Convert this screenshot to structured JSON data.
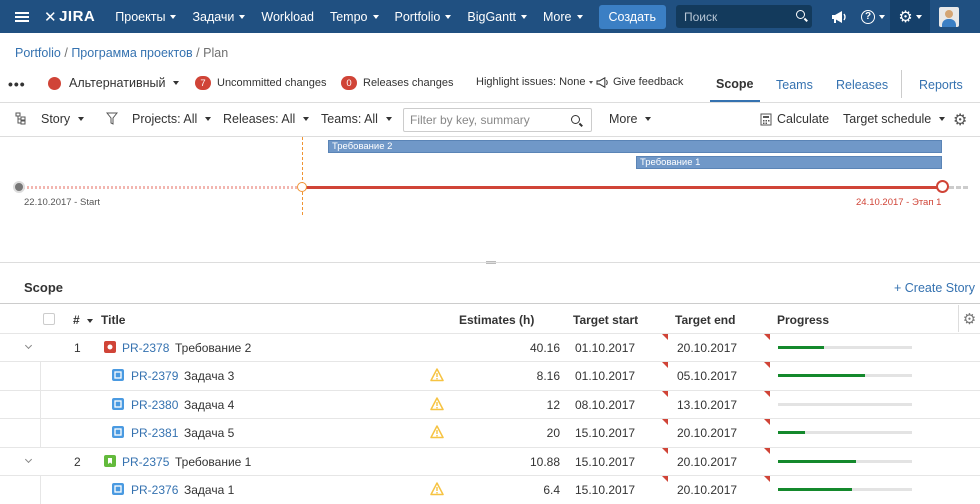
{
  "topnav": {
    "logo": "JIRA",
    "items": [
      "Проекты",
      "Задачи",
      "Workload",
      "Tempo",
      "Portfolio",
      "BigGantt",
      "More"
    ],
    "create_label": "Создать",
    "search_placeholder": "Поиск",
    "help_glyph": "?"
  },
  "breadcrumb": {
    "part1": "Portfolio",
    "part2": "Программа проектов",
    "part3": "Plan",
    "sep": "/"
  },
  "toolbar2": {
    "dots": "•••",
    "scenario": "Альтернативный",
    "uncommitted_count": "7",
    "uncommitted_label": "Uncommitted changes",
    "releases_count": "0",
    "releases_label": "Releases changes",
    "highlight": "Highlight issues: None",
    "feedback": "Give feedback",
    "tabs": [
      "Scope",
      "Teams",
      "Releases",
      "Reports"
    ]
  },
  "filters": {
    "story": "Story",
    "projects": "Projects: All",
    "releases": "Releases: All",
    "teams": "Teams: All",
    "filter_placeholder": "Filter by key, summary",
    "more": "More",
    "calculate": "Calculate",
    "target_schedule": "Target schedule"
  },
  "timeline": {
    "bars": [
      "Требование 2",
      "Требование 1"
    ],
    "start_label": "22.10.2017 - Start",
    "end_label": "24.10.2017 - Этап 1"
  },
  "scope": {
    "title": "Scope",
    "create_story": "+ Create Story",
    "columns": [
      "#",
      "Title",
      "Estimates (h)",
      "Target start",
      "Target end",
      "Progress"
    ],
    "rows": [
      {
        "num": "1",
        "key": "PR-2378",
        "title": "Требование 2",
        "est": "40.16",
        "start": "01.10.2017",
        "end": "20.10.2017",
        "progress": 0.34,
        "level": 0,
        "type": "epic",
        "warn": false
      },
      {
        "num": "",
        "key": "PR-2379",
        "title": "Задача 3",
        "est": "8.16",
        "start": "01.10.2017",
        "end": "05.10.2017",
        "progress": 0.65,
        "level": 1,
        "type": "task",
        "warn": true
      },
      {
        "num": "",
        "key": "PR-2380",
        "title": "Задача 4",
        "est": "12",
        "start": "08.10.2017",
        "end": "13.10.2017",
        "progress": 0.0,
        "level": 1,
        "type": "task",
        "warn": true
      },
      {
        "num": "",
        "key": "PR-2381",
        "title": "Задача 5",
        "est": "20",
        "start": "15.10.2017",
        "end": "20.10.2017",
        "progress": 0.2,
        "level": 1,
        "type": "task",
        "warn": true
      },
      {
        "num": "2",
        "key": "PR-2375",
        "title": "Требование 1",
        "est": "10.88",
        "start": "15.10.2017",
        "end": "20.10.2017",
        "progress": 0.58,
        "level": 0,
        "type": "story",
        "warn": false
      },
      {
        "num": "",
        "key": "PR-2376",
        "title": "Задача 1",
        "est": "6.4",
        "start": "15.10.2017",
        "end": "20.10.2017",
        "progress": 0.55,
        "level": 1,
        "type": "task",
        "warn": true
      }
    ]
  },
  "colors": {
    "nav_bg": "#205081",
    "accent": "#3572b0",
    "danger": "#d04437",
    "progress": "#14892c",
    "timeline_bar": "#7098c8"
  }
}
